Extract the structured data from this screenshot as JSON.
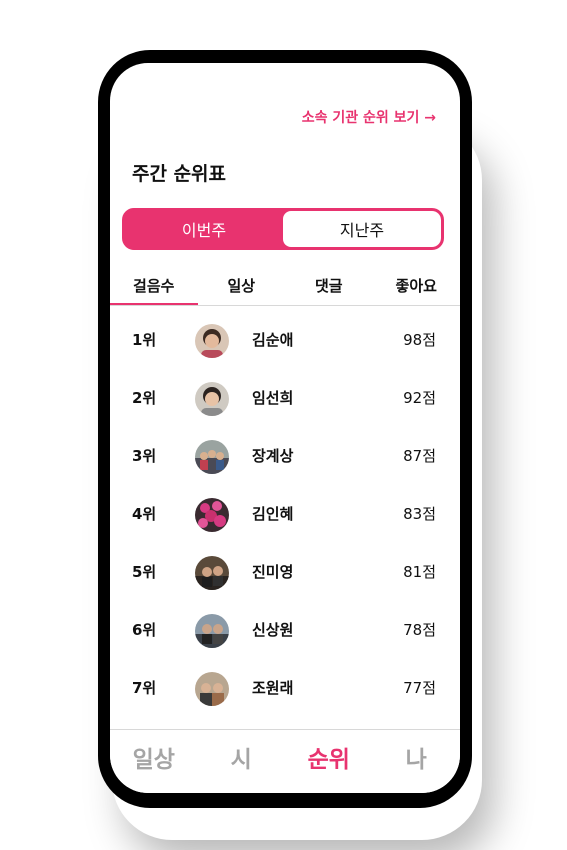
{
  "header": {
    "org_link": "소속 기관 순위 보기 →",
    "title": "주간 순위표"
  },
  "period_toggle": {
    "this_week": "이번주",
    "last_week": "지난주",
    "selected": "이번주"
  },
  "category_tabs": [
    "걸음수",
    "일상",
    "댓글",
    "좋아요"
  ],
  "selected_category": "걸음수",
  "ranking": [
    {
      "rank": "1위",
      "name": "김순애",
      "score": "98점"
    },
    {
      "rank": "2위",
      "name": "임선희",
      "score": "92점"
    },
    {
      "rank": "3위",
      "name": "장계상",
      "score": "87점"
    },
    {
      "rank": "4위",
      "name": "김인혜",
      "score": "83점"
    },
    {
      "rank": "5위",
      "name": "진미영",
      "score": "81점"
    },
    {
      "rank": "6위",
      "name": "신상원",
      "score": "78점"
    },
    {
      "rank": "7위",
      "name": "조원래",
      "score": "77점"
    }
  ],
  "bottom_nav": [
    "일상",
    "시",
    "순위",
    "나"
  ],
  "bottom_nav_selected": "순위",
  "colors": {
    "accent": "#e8336f",
    "inactive_nav": "#a5a5a5"
  }
}
